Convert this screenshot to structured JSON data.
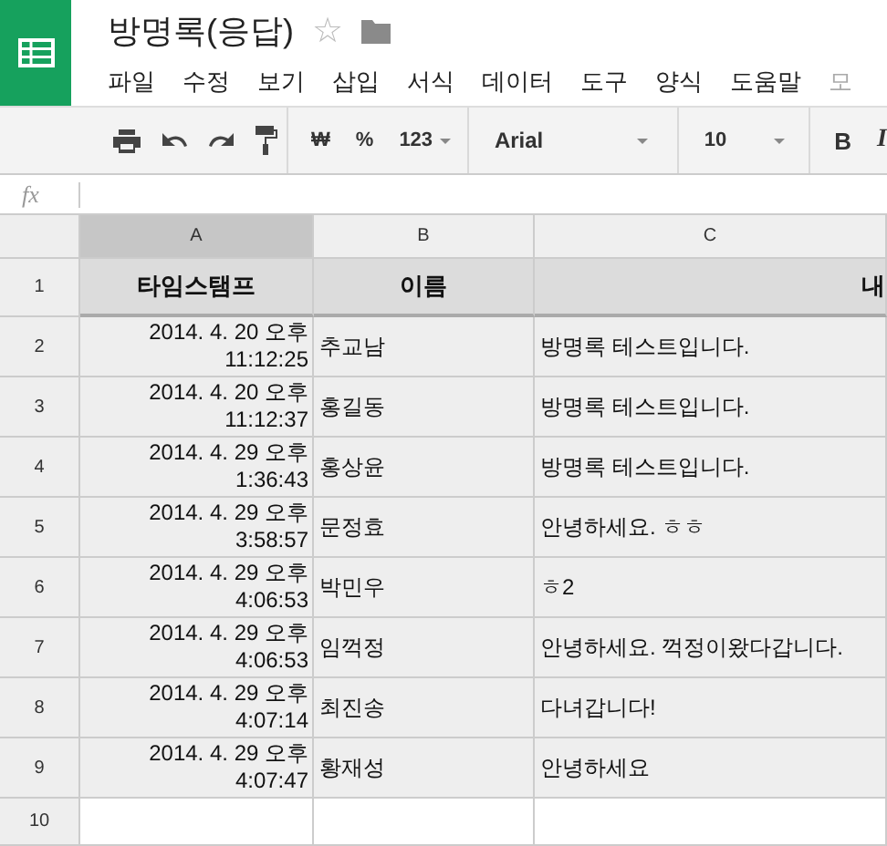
{
  "document": {
    "title": "방명록(응답)",
    "star": "☆",
    "starred": false
  },
  "menu": [
    {
      "label": "파일",
      "disabled": false
    },
    {
      "label": "수정",
      "disabled": false
    },
    {
      "label": "보기",
      "disabled": false
    },
    {
      "label": "삽입",
      "disabled": false
    },
    {
      "label": "서식",
      "disabled": false
    },
    {
      "label": "데이터",
      "disabled": false
    },
    {
      "label": "도구",
      "disabled": false
    },
    {
      "label": "양식",
      "disabled": false
    },
    {
      "label": "도움말",
      "disabled": false
    },
    {
      "label": "모",
      "disabled": true
    }
  ],
  "toolbar": {
    "currency": "₩",
    "percent": "%",
    "number_format": "123",
    "font": "Arial",
    "font_size": "10",
    "bold": "B",
    "italic": "I"
  },
  "formula_bar": {
    "label": "fx"
  },
  "columns": [
    {
      "label": "A",
      "selected": true
    },
    {
      "label": "B",
      "selected": false
    },
    {
      "label": "C",
      "selected": false
    }
  ],
  "rows": [
    {
      "number": "1",
      "kind": "header",
      "cells": [
        "타임스탬프",
        "이름",
        "내"
      ]
    },
    {
      "number": "2",
      "kind": "data",
      "cells": [
        "2014. 4. 20 오후 11:12:25",
        "추교남",
        "방명록 테스트입니다."
      ]
    },
    {
      "number": "3",
      "kind": "data",
      "cells": [
        "2014. 4. 20 오후 11:12:37",
        "홍길동",
        "방명록 테스트입니다."
      ]
    },
    {
      "number": "4",
      "kind": "data",
      "cells": [
        "2014. 4. 29 오후 1:36:43",
        "홍상윤",
        "방명록 테스트입니다."
      ]
    },
    {
      "number": "5",
      "kind": "data",
      "cells": [
        "2014. 4. 29 오후 3:58:57",
        "문정효",
        "안녕하세요. ㅎㅎ"
      ]
    },
    {
      "number": "6",
      "kind": "data",
      "cells": [
        "2014. 4. 29 오후 4:06:53",
        "박민우",
        "ㅎ2"
      ]
    },
    {
      "number": "7",
      "kind": "data",
      "cells": [
        "2014. 4. 29 오후 4:06:53",
        "임꺽정",
        "안녕하세요. 꺽정이왔다갑니다."
      ]
    },
    {
      "number": "8",
      "kind": "data",
      "cells": [
        "2014. 4. 29 오후 4:07:14",
        "최진송",
        "다녀갑니다!"
      ]
    },
    {
      "number": "9",
      "kind": "data",
      "cells": [
        "2014. 4. 29 오후 4:07:47",
        "황재성",
        "안녕하세요"
      ]
    },
    {
      "number": "10",
      "kind": "empty",
      "cells": [
        "",
        "",
        ""
      ]
    }
  ]
}
